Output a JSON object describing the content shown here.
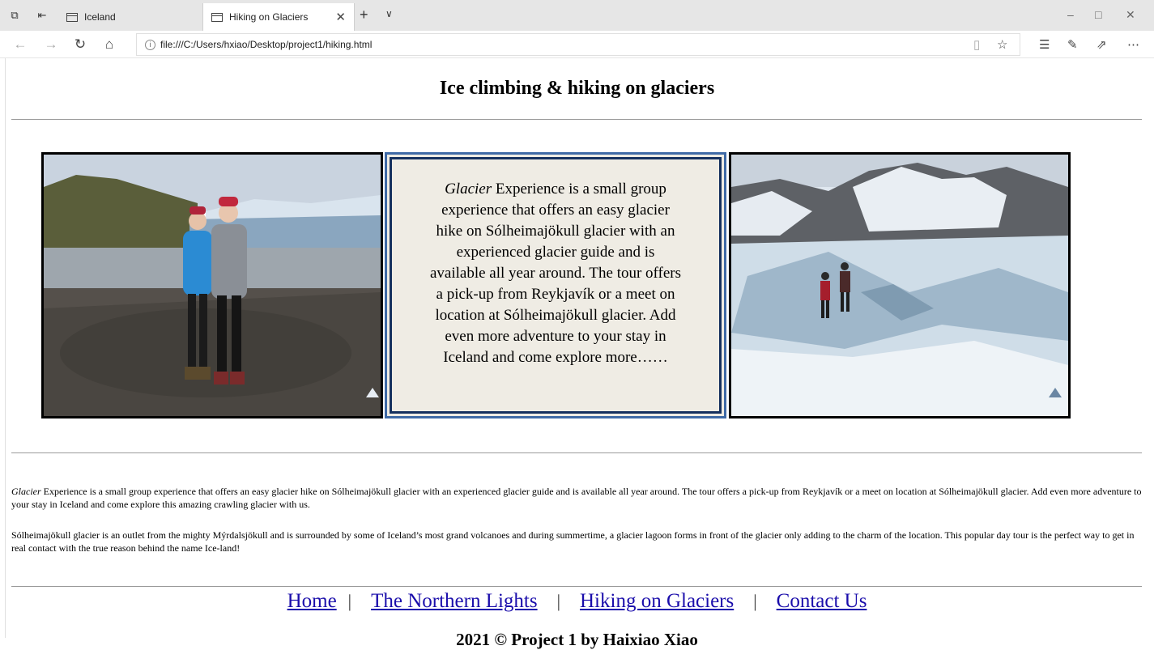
{
  "browser": {
    "tabs": [
      {
        "label": "Iceland",
        "active": false
      },
      {
        "label": "Hiking on Glaciers",
        "active": true
      }
    ],
    "url": "file:///C:/Users/hxiao/Desktop/project1/hiking.html",
    "icons": [
      "tab-actions-icon",
      "set-aside-icon",
      "page-icon",
      "close-icon",
      "new-tab-icon",
      "tab-list-icon",
      "minimize-icon",
      "maximize-icon",
      "window-close-icon",
      "back-icon",
      "forward-icon",
      "refresh-icon",
      "home-icon",
      "info-icon",
      "reading-view-icon",
      "favorite-icon",
      "favorites-list-icon",
      "pen-icon",
      "share-icon",
      "more-icon"
    ]
  },
  "page": {
    "title": "Ice climbing & hiking on glaciers",
    "box": {
      "emph": "Glacier",
      "text": " Experience is a small group experience that offers an easy glacier hike on Sólheimajökull glacier with an experienced glacier guide and is available all year around. The tour offers a pick-up from Reykjavík or a meet on location at Sólheimajökull glacier. Add even more adventure to your stay in Iceland and come explore more……"
    },
    "para1": {
      "emph": "Glacier",
      "text": " Experience is a small group experience that offers an easy glacier hike on Sólheimajökull glacier with an experienced glacier guide and is available all year around. The tour offers a pick-up from Reykjavík or a meet on location at Sólheimajökull glacier. Add even more adventure to your stay in Iceland and come explore this amazing crawling glacier with us."
    },
    "para2": "Sólheimajökull glacier is an outlet from the mighty Mýrdalsjökull and is surrounded by some of Iceland’s most grand volcanoes and during summertime, a glacier lagoon forms in front of the glacier only adding to the charm of the location. This popular day tour is the perfect way to get in real contact with the true reason behind the name Ice-land!",
    "nav": {
      "home": "Home",
      "northern_lights": "The Northern Lights",
      "hiking": "Hiking on Glaciers",
      "contact": "Contact Us",
      "separator": "|"
    },
    "copyright": "2021 © Project 1 by Haixiao Xiao"
  },
  "colors": {
    "link": "#1a0dab",
    "box_border": "#3f6aa6",
    "box_bg": "#efece4"
  }
}
